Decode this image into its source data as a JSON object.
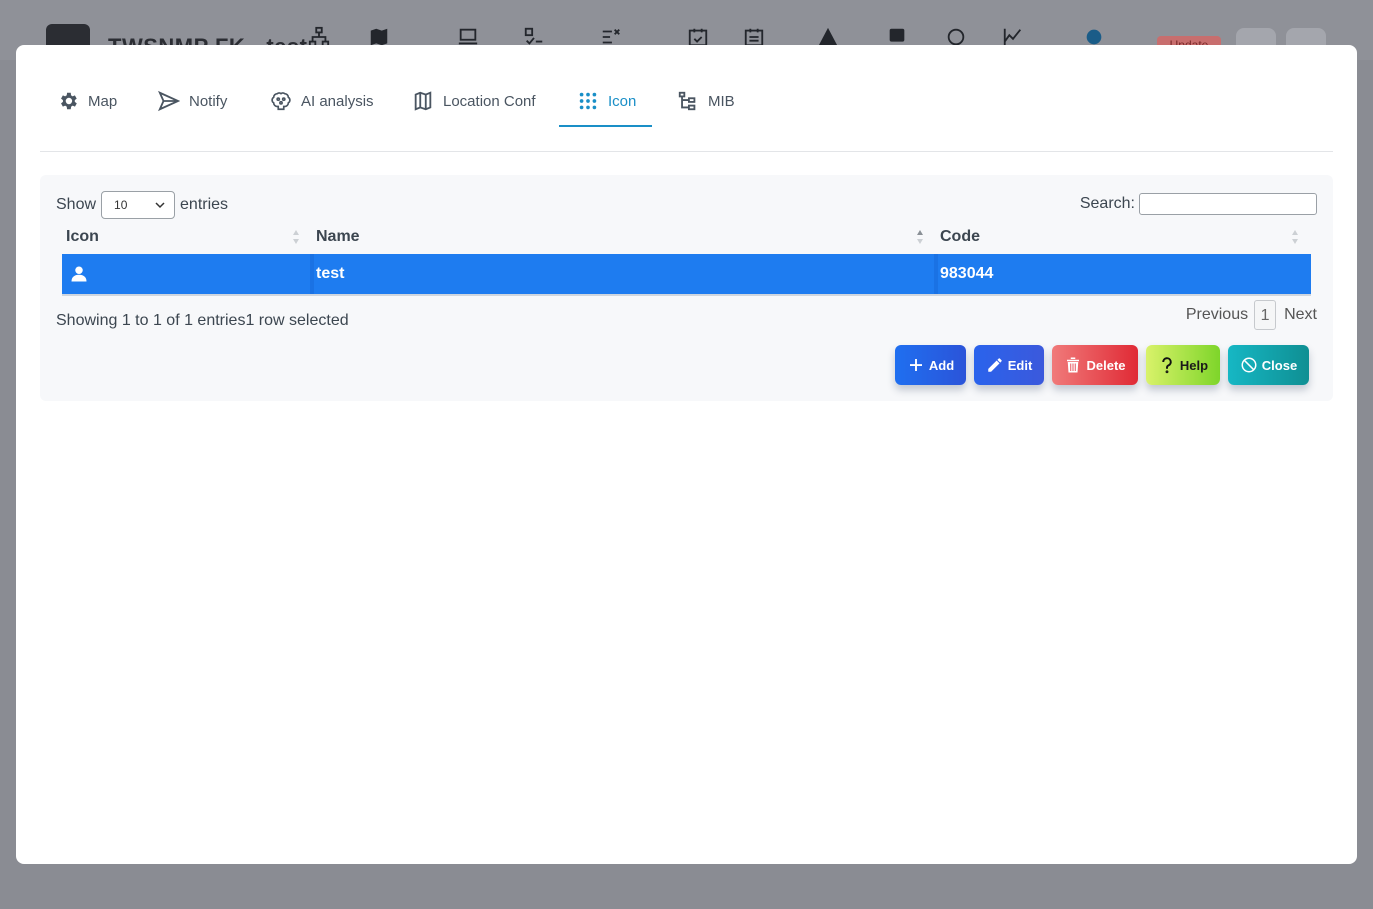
{
  "background": {
    "app_title": "TWSNMP FK - test",
    "update_label": "Update"
  },
  "tabs": [
    {
      "label": "Map",
      "icon": "gear-icon"
    },
    {
      "label": "Notify",
      "icon": "send-icon"
    },
    {
      "label": "AI analysis",
      "icon": "brain-icon"
    },
    {
      "label": "Location Conf",
      "icon": "map-icon"
    },
    {
      "label": "Icon",
      "icon": "dots-grid-icon",
      "active": true
    },
    {
      "label": "MIB",
      "icon": "tree-icon"
    }
  ],
  "table": {
    "show_label": "Show",
    "entries_label": "entries",
    "page_size": "10",
    "search_label": "Search:",
    "search_value": "",
    "columns": [
      "Icon",
      "Name",
      "Code"
    ],
    "rows": [
      {
        "icon": "user-icon",
        "name": "test",
        "code": "983044",
        "selected": true
      }
    ],
    "info": "Showing 1 to 1 of 1 entries1 row selected",
    "previous_label": "Previous",
    "page": "1",
    "next_label": "Next"
  },
  "buttons": {
    "add": "Add",
    "edit": "Edit",
    "delete": "Delete",
    "help": "Help",
    "close": "Close"
  },
  "colors": {
    "accent": "#1a8fc7",
    "selected_row": "#1e7cf0",
    "add": "#1f6ff0",
    "delete": "#e02a35",
    "help": "#9be03a",
    "close": "#13a4ae"
  }
}
